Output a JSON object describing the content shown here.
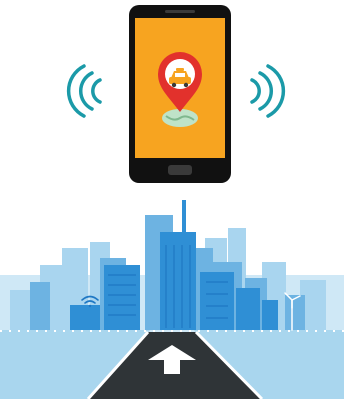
{
  "illustration": {
    "phone": {
      "screen_color": "#f7a420",
      "frame_color": "#111111",
      "pin_color": "#e2312c",
      "pin_icon": "car-icon"
    },
    "signal_waves": {
      "color": "#1b9aa8",
      "icon": "wifi-broadcast-icon"
    },
    "city": {
      "sky_color": "#bfe0f3",
      "building_colors": [
        "#a9d5ef",
        "#6db3e2",
        "#2f8fd5",
        "#1f78c4"
      ],
      "icons": [
        "wifi-icon",
        "wind-turbine-icon"
      ]
    },
    "road": {
      "color": "#2f3437",
      "edge_color": "#ffffff",
      "arrow_icon": "up-arrow-icon"
    }
  }
}
